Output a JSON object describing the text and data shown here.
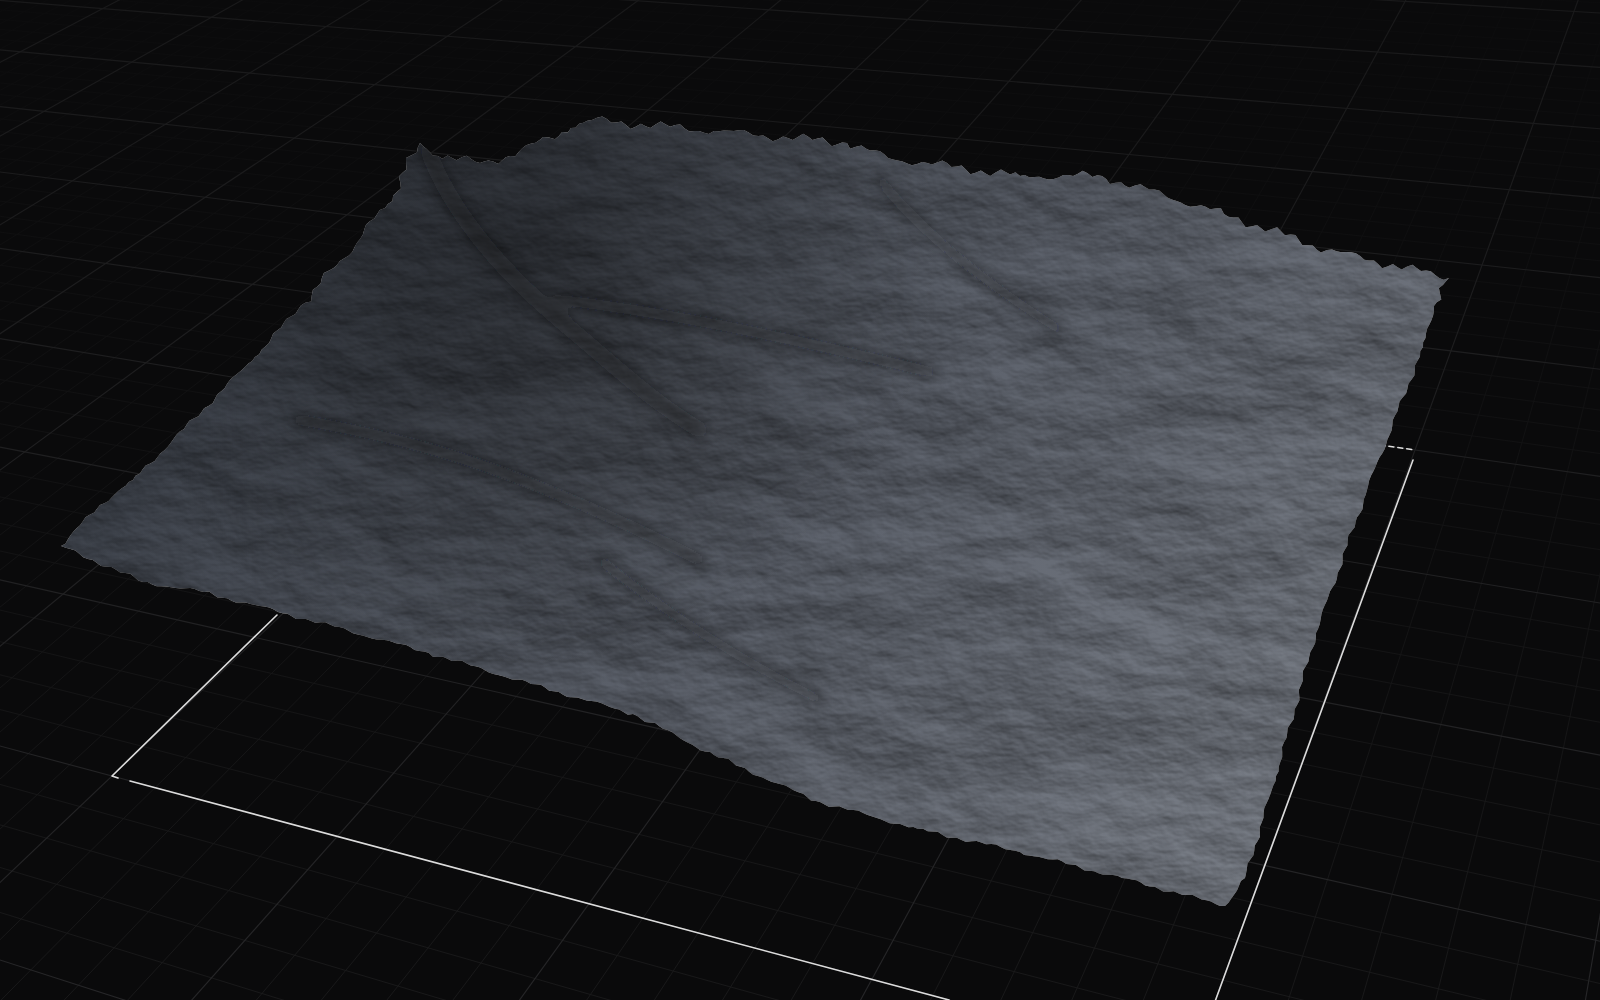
{
  "viewport": {
    "show_grid": true,
    "object": {
      "kind": "terrain",
      "selected": true
    }
  }
}
